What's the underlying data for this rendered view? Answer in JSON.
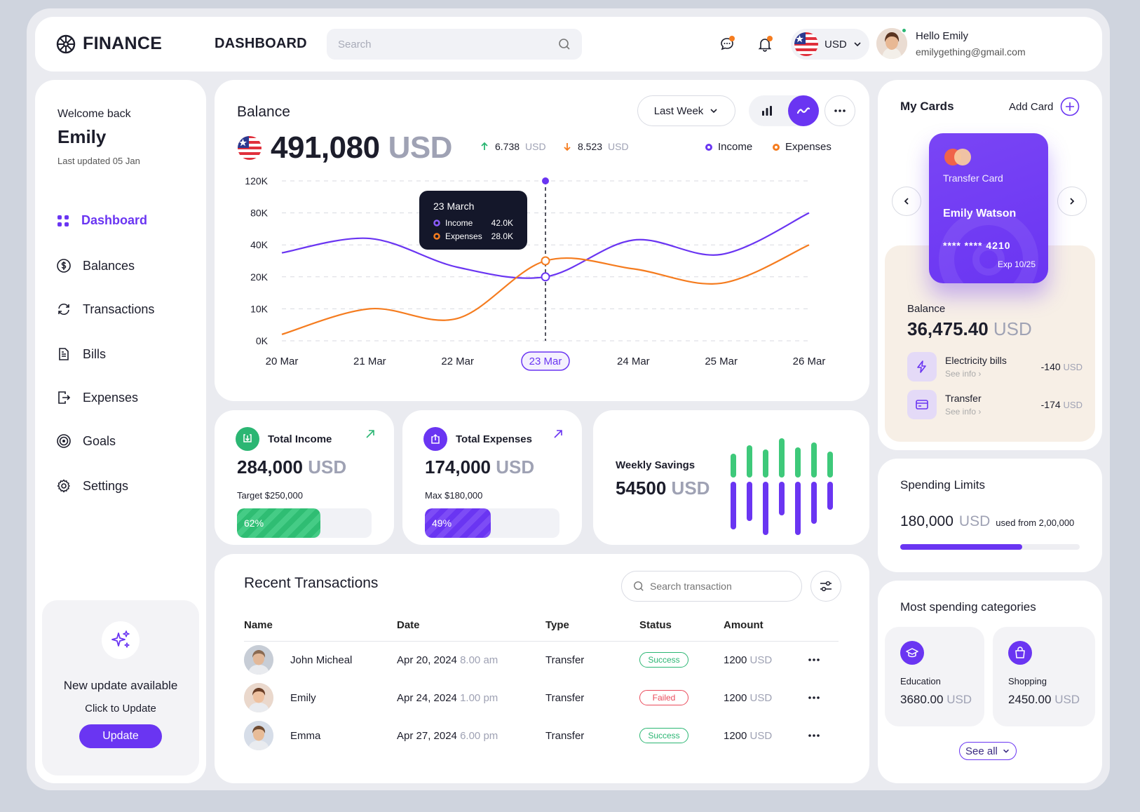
{
  "app": {
    "brand": "FINANCE",
    "page_title": "DASHBOARD"
  },
  "header": {
    "search_placeholder": "Search",
    "currency": "USD",
    "greeting": "Hello Emily",
    "email": "emilygething@gmail.com"
  },
  "sidebar": {
    "welcome": "Welcome back",
    "user": "Emily",
    "last_updated": "Last updated 05 Jan",
    "items": [
      {
        "label": "Dashboard",
        "icon": "grid-icon",
        "active": true
      },
      {
        "label": "Balances",
        "icon": "dollar-icon"
      },
      {
        "label": "Transactions",
        "icon": "exchange-icon"
      },
      {
        "label": "Bills",
        "icon": "document-icon"
      },
      {
        "label": "Expenses",
        "icon": "export-icon"
      },
      {
        "label": "Goals",
        "icon": "target-icon"
      },
      {
        "label": "Settings",
        "icon": "gear-icon"
      }
    ],
    "update": {
      "title": "New update available",
      "subtitle": "Click to Update",
      "button": "Update"
    }
  },
  "balance": {
    "title": "Balance",
    "amount": "491,080",
    "currency": "USD",
    "up_value": "6.738",
    "up_currency": "USD",
    "down_value": "8.523",
    "down_currency": "USD",
    "legend_income": "Income",
    "legend_expenses": "Expenses",
    "period": "Last Week",
    "tooltip": {
      "date": "23 March",
      "income_label": "Income",
      "income_value": "42.0K",
      "expenses_label": "Expenses",
      "expenses_value": "28.0K"
    }
  },
  "chart_data": {
    "type": "line",
    "x": [
      "20 Mar",
      "21 Mar",
      "22 Mar",
      "23 Mar",
      "24 Mar",
      "25 Mar",
      "26 Mar"
    ],
    "y_ticks": [
      "120K",
      "80K",
      "40K",
      "20K",
      "10K",
      "0K"
    ],
    "highlight": "23 Mar",
    "series": [
      {
        "name": "Income",
        "color": "#6a35f2",
        "values": [
          35000,
          48000,
          26000,
          20000,
          46000,
          34000,
          80000
        ]
      },
      {
        "name": "Expenses",
        "color": "#f57c1f",
        "values": [
          2000,
          10000,
          7000,
          30000,
          25000,
          18000,
          40000
        ]
      }
    ]
  },
  "income": {
    "title": "Total Income",
    "value": "284,000",
    "currency": "USD",
    "target": "Target $250,000",
    "percent": "62%",
    "fraction": 0.62
  },
  "expenses": {
    "title": "Total Expenses",
    "value": "174,000",
    "currency": "USD",
    "max": "Max $180,000",
    "percent": "49%",
    "fraction": 0.49
  },
  "savings": {
    "title": "Weekly Savings",
    "value": "54500",
    "currency": "USD",
    "bars": [
      {
        "green": 0.55,
        "purple": 0.85
      },
      {
        "green": 0.75,
        "purple": 0.7
      },
      {
        "green": 0.65,
        "purple": 0.95
      },
      {
        "green": 0.9,
        "purple": 0.6
      },
      {
        "green": 0.7,
        "purple": 0.95
      },
      {
        "green": 0.8,
        "purple": 0.75
      },
      {
        "green": 0.6,
        "purple": 0.5
      }
    ]
  },
  "transactions": {
    "title": "Recent Transactions",
    "search_placeholder": "Search transaction",
    "columns": [
      "Name",
      "Date",
      "Type",
      "Status",
      "Amount"
    ],
    "rows": [
      {
        "name": "John Micheal",
        "date": "Apr 20, 2024",
        "time": "8.00 am",
        "type": "Transfer",
        "status": "Success",
        "amount": "1200",
        "currency": "USD"
      },
      {
        "name": "Emily",
        "date": "Apr 24, 2024",
        "time": "1.00 pm",
        "type": "Transfer",
        "status": "Failed",
        "amount": "1200",
        "currency": "USD"
      },
      {
        "name": "Emma",
        "date": "Apr 27, 2024",
        "time": "6.00 pm",
        "type": "Transfer",
        "status": "Success",
        "amount": "1200",
        "currency": "USD"
      }
    ]
  },
  "cards": {
    "title": "My Cards",
    "add": "Add Card",
    "card": {
      "label": "Transfer Card",
      "holder": "Emily Watson",
      "number": "**** **** 4210",
      "expiry": "Exp 10/25"
    },
    "balance_label": "Balance",
    "balance_value": "36,475.40",
    "balance_currency": "USD",
    "items": [
      {
        "name": "Electricity bills",
        "sub": "See info",
        "amount": "-140",
        "currency": "USD"
      },
      {
        "name": "Transfer",
        "sub": "See info",
        "amount": "-174",
        "currency": "USD"
      }
    ]
  },
  "limits": {
    "title": "Spending Limits",
    "value": "180,000",
    "currency": "USD",
    "note": "used from 2,00,000",
    "fraction": 0.68
  },
  "categories": {
    "title": "Most spending categories",
    "items": [
      {
        "name": "Education",
        "value": "3680.00",
        "currency": "USD"
      },
      {
        "name": "Shopping",
        "value": "2450.00",
        "currency": "USD"
      }
    ],
    "see_all": "See all"
  }
}
